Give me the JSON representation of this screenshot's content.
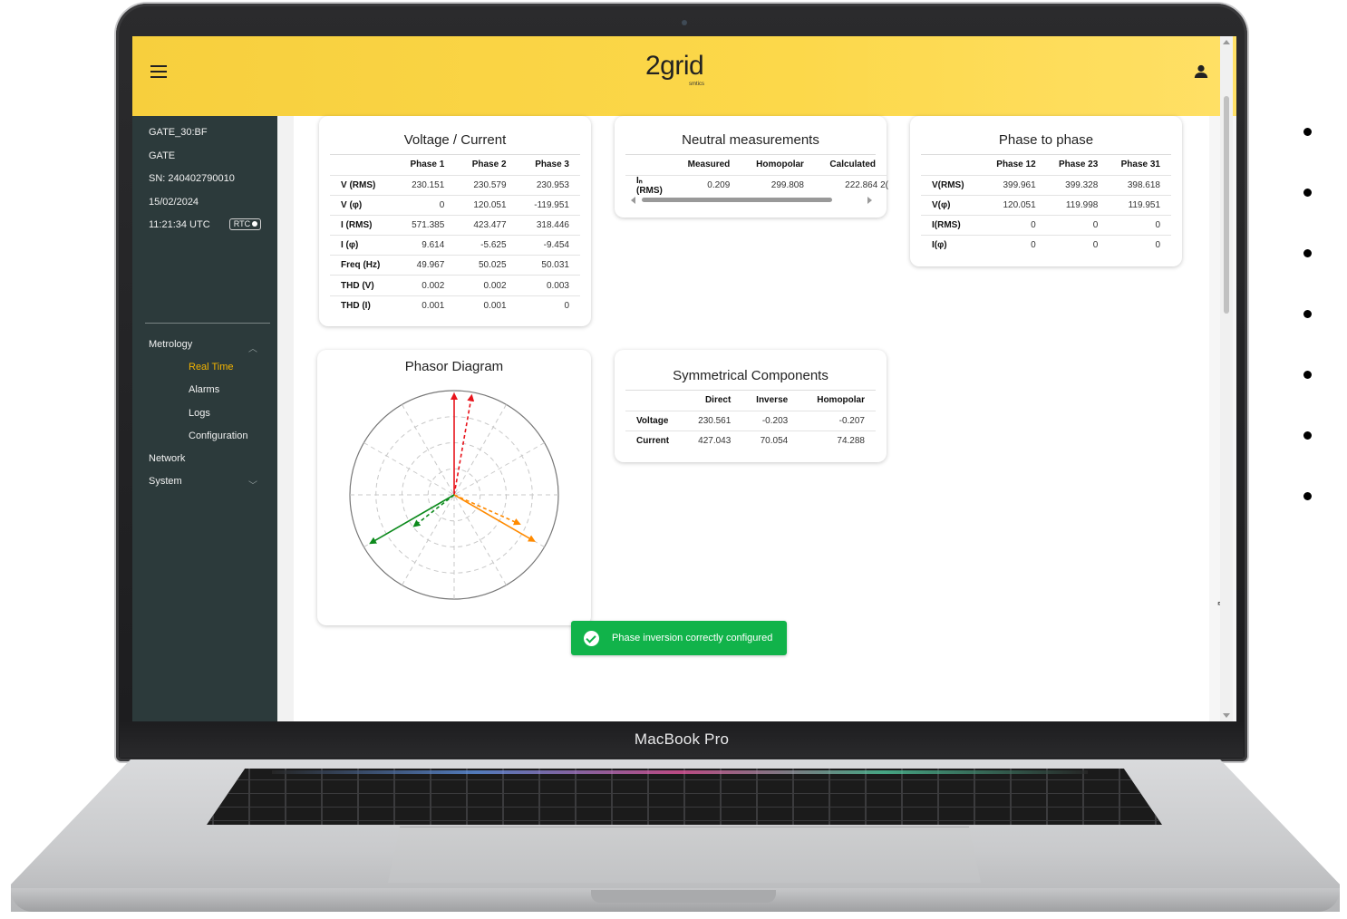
{
  "device": {
    "brand_label": "MacBook Pro"
  },
  "header": {
    "logo_text": "2grid",
    "logo_subtext": "smtics",
    "accent": "#fcd84a"
  },
  "sidebar": {
    "device_name": "GATE_30:BF",
    "device_type": "GATE",
    "serial": "SN: 240402790010",
    "date": "15/02/2024",
    "time": "11:21:34 UTC",
    "rtc_label": "RTC",
    "items": [
      {
        "label": "Metrology",
        "expanded": true
      },
      {
        "label": "Real Time",
        "active": true
      },
      {
        "label": "Alarms"
      },
      {
        "label": "Logs"
      },
      {
        "label": "Configuration"
      },
      {
        "label": "Network"
      },
      {
        "label": "System",
        "expanded": false
      }
    ],
    "active_color": "#f4b400"
  },
  "voltage_current": {
    "title": "Voltage / Current",
    "columns": [
      "Phase 1",
      "Phase 2",
      "Phase 3"
    ],
    "rows": [
      {
        "label": "V (RMS)",
        "values": [
          "230.151",
          "230.579",
          "230.953"
        ]
      },
      {
        "label": "V (φ)",
        "values": [
          "0",
          "120.051",
          "-119.951"
        ]
      },
      {
        "label": "I (RMS)",
        "values": [
          "571.385",
          "423.477",
          "318.446"
        ]
      },
      {
        "label": "I (φ)",
        "values": [
          "9.614",
          "-5.625",
          "-9.454"
        ]
      },
      {
        "label": "Freq (Hz)",
        "values": [
          "49.967",
          "50.025",
          "50.031"
        ]
      },
      {
        "label": "THD (V)",
        "values": [
          "0.002",
          "0.002",
          "0.003"
        ]
      },
      {
        "label": "THD (I)",
        "values": [
          "0.001",
          "0.001",
          "0"
        ]
      }
    ]
  },
  "neutral": {
    "title": "Neutral measurements",
    "columns": [
      "Measured",
      "Homopolar",
      "Calculated"
    ],
    "row_label": "Iₙ (RMS)",
    "values": [
      "0.209",
      "299.808",
      "222.864"
    ],
    "overflow_value": "2("
  },
  "phase_to_phase": {
    "title": "Phase to phase",
    "columns": [
      "Phase 12",
      "Phase 23",
      "Phase 31"
    ],
    "rows": [
      {
        "label": "V(RMS)",
        "values": [
          "399.961",
          "399.328",
          "398.618"
        ]
      },
      {
        "label": "V(φ)",
        "values": [
          "120.051",
          "119.998",
          "119.951"
        ]
      },
      {
        "label": "I(RMS)",
        "values": [
          "0",
          "0",
          "0"
        ]
      },
      {
        "label": "I(φ)",
        "values": [
          "0",
          "0",
          "0"
        ]
      }
    ]
  },
  "phasor": {
    "title": "Phasor Diagram",
    "vectors": [
      {
        "angle_deg": 90,
        "magnitude": 1.0,
        "style": "solid",
        "color": "#e8141c"
      },
      {
        "angle_deg": 80,
        "magnitude": 1.0,
        "style": "dashed",
        "color": "#e8141c"
      },
      {
        "angle_deg": -30,
        "magnitude": 0.92,
        "style": "solid",
        "color": "#ff8a00"
      },
      {
        "angle_deg": -24,
        "magnitude": 0.72,
        "style": "dashed",
        "color": "#ff8a00"
      },
      {
        "angle_deg": -150,
        "magnitude": 0.96,
        "style": "solid",
        "color": "#0c8a1c"
      },
      {
        "angle_deg": -142,
        "magnitude": 0.52,
        "style": "dashed",
        "color": "#0c8a1c"
      }
    ]
  },
  "symmetrical": {
    "title": "Symmetrical Components",
    "columns": [
      "Direct",
      "Inverse",
      "Homopolar"
    ],
    "rows": [
      {
        "label": "Voltage",
        "values": [
          "230.561",
          "-0.203",
          "-0.207"
        ]
      },
      {
        "label": "Current",
        "values": [
          "427.043",
          "70.054",
          "74.288"
        ]
      }
    ]
  },
  "toast": {
    "message": "Phase inversion correctly configured",
    "color": "#11b34a"
  }
}
